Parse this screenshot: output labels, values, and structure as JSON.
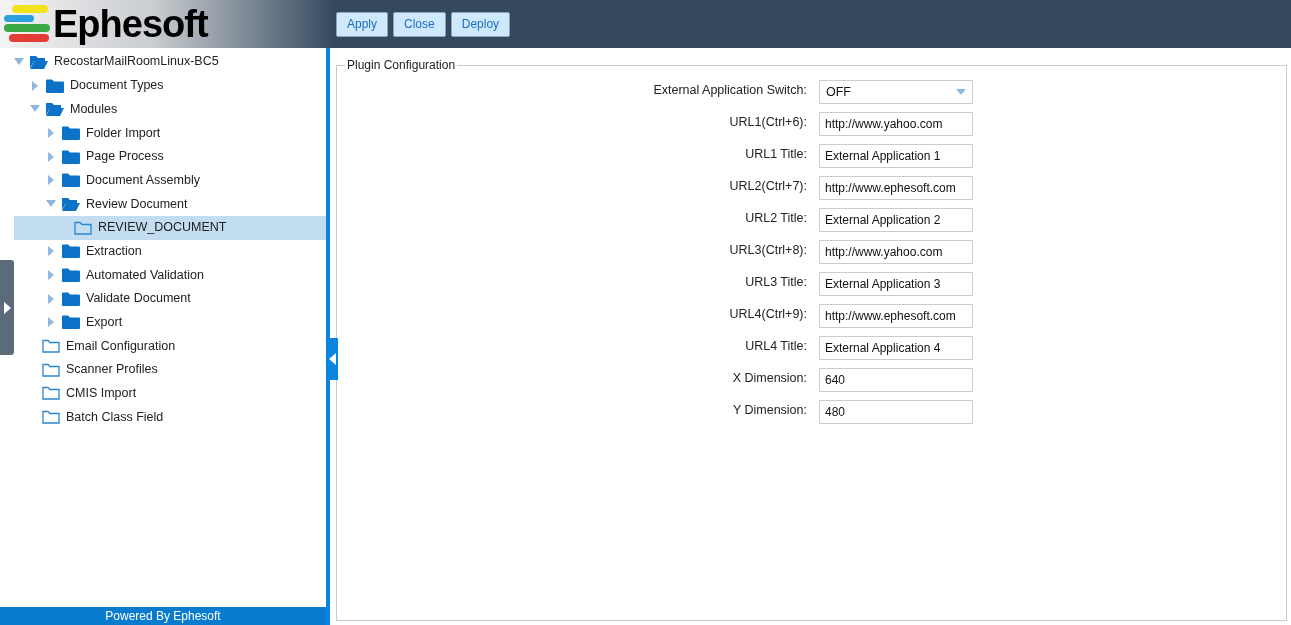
{
  "header": {
    "logo_text": "Ephesoft",
    "buttons": [
      "Apply",
      "Close",
      "Deploy"
    ]
  },
  "tree": [
    {
      "label": "RecostarMailRoomLinux-BC5",
      "expanded": true,
      "selected": false,
      "children": [
        {
          "label": "Document Types",
          "expanded": false,
          "selected": false
        },
        {
          "label": "Modules",
          "expanded": true,
          "selected": false,
          "children": [
            {
              "label": "Folder Import",
              "expanded": false,
              "selected": false
            },
            {
              "label": "Page Process",
              "expanded": false,
              "selected": false
            },
            {
              "label": "Document Assembly",
              "expanded": false,
              "selected": false
            },
            {
              "label": "Review Document",
              "expanded": true,
              "selected": false,
              "children": [
                {
                  "label": "REVIEW_DOCUMENT",
                  "selected": true
                }
              ]
            },
            {
              "label": "Extraction",
              "expanded": false,
              "selected": false
            },
            {
              "label": "Automated Validation",
              "expanded": false,
              "selected": false
            },
            {
              "label": "Validate Document",
              "expanded": false,
              "selected": false
            },
            {
              "label": "Export",
              "expanded": false,
              "selected": false
            }
          ]
        },
        {
          "label": "Email Configuration",
          "selected": false
        },
        {
          "label": "Scanner Profiles",
          "selected": false
        },
        {
          "label": "CMIS Import",
          "selected": false
        },
        {
          "label": "Batch Class Field",
          "selected": false
        }
      ]
    }
  ],
  "footer": "Powered By Ephesoft",
  "panel": {
    "title": "Plugin Configuration",
    "fields": [
      {
        "kind": "select",
        "label": "External Application Switch:",
        "value": "OFF"
      },
      {
        "kind": "text",
        "label": "URL1(Ctrl+6):",
        "value": "http://www.yahoo.com"
      },
      {
        "kind": "text",
        "label": "URL1 Title:",
        "value": "External Application 1"
      },
      {
        "kind": "text",
        "label": "URL2(Ctrl+7):",
        "value": "http://www.ephesoft.com"
      },
      {
        "kind": "text",
        "label": "URL2 Title:",
        "value": "External Application 2"
      },
      {
        "kind": "text",
        "label": "URL3(Ctrl+8):",
        "value": "http://www.yahoo.com"
      },
      {
        "kind": "text",
        "label": "URL3 Title:",
        "value": "External Application 3"
      },
      {
        "kind": "text",
        "label": "URL4(Ctrl+9):",
        "value": "http://www.ephesoft.com"
      },
      {
        "kind": "text",
        "label": "URL4 Title:",
        "value": "External Application 4"
      },
      {
        "kind": "text",
        "label": "X Dimension:",
        "value": "640"
      },
      {
        "kind": "text",
        "label": "Y Dimension:",
        "value": "480"
      }
    ]
  }
}
